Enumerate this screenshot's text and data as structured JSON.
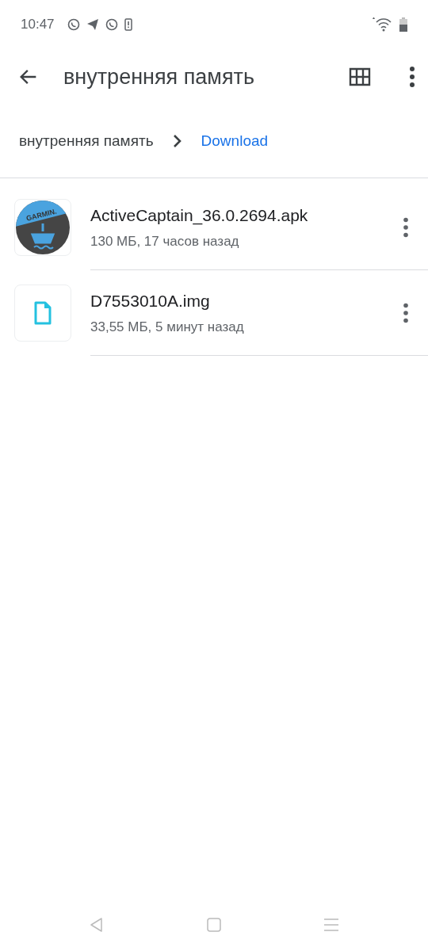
{
  "status_bar": {
    "time": "10:47"
  },
  "toolbar": {
    "title": "внутренняя память"
  },
  "breadcrumbs": [
    {
      "label": "внутренняя память",
      "selected": false
    },
    {
      "label": "Download",
      "selected": true
    }
  ],
  "files": [
    {
      "kind": "app",
      "icon_label": "GARMIN.",
      "name": "ActiveCaptain_36.0.2694.apk",
      "details": "130 МБ, 17 часов назад"
    },
    {
      "kind": "document",
      "name": "D7553010A.img",
      "details": "33,55 МБ, 5 минут назад"
    }
  ]
}
